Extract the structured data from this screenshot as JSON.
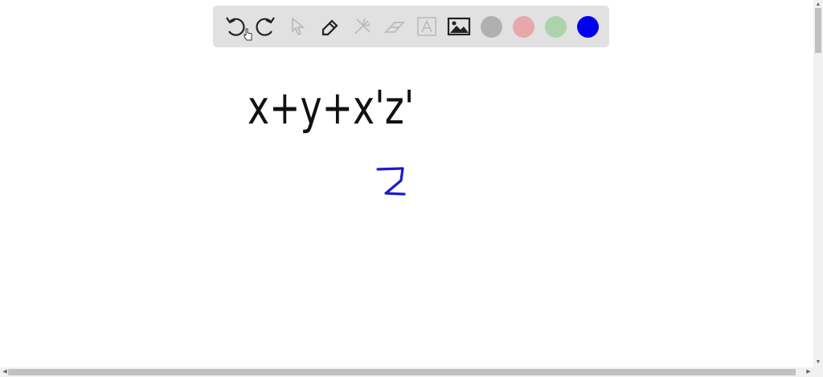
{
  "toolbar": {
    "tools": [
      "undo-icon",
      "redo-icon",
      "select-icon",
      "pen-icon",
      "tools-icon",
      "eraser-icon",
      "text-icon",
      "image-icon"
    ],
    "colors": [
      "#b0b0b0",
      "#e8a7aa",
      "#acd4ac",
      "#0000ee"
    ],
    "selected_color": "#0000ee"
  },
  "canvas": {
    "handwriting": [
      "x+y+x'z'",
      "2"
    ],
    "ink_colors": {
      "black": "#111111",
      "blue": "#1a1ad0"
    }
  }
}
